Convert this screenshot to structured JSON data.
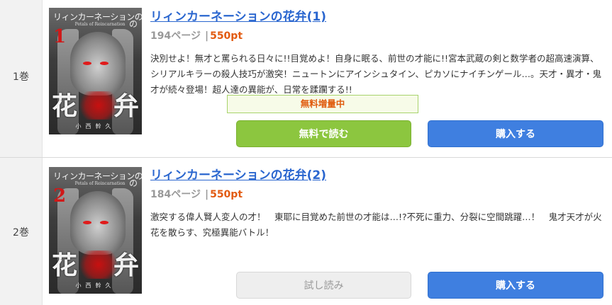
{
  "items": [
    {
      "volume": "1巻",
      "title": "リィンカーネーションの花弁(1)",
      "pages": "194ページ",
      "separator": "|",
      "price": "550pt",
      "description": "決別せよ！無才と罵られる日々に!!目覚めよ！自身に眠る、前世の才能に!!宮本武蔵の剣と数学者の超高速演算、シリアルキラーの殺人技巧が激突！ニュートンにアインシュタイン、ピカソにナイチンゲール…。天才・異才・鬼才が続々登場！超人達の異能が、日常を蹂躙する!!",
      "promo": "無料増量中",
      "primary_button": "無料で読む",
      "buy_button": "購入する",
      "cover": {
        "series_title": "リィンカーネーションの",
        "subtitle": "Petals of Reincarnation",
        "number": "1",
        "no": "の",
        "big_left": "花",
        "big_right": "弁",
        "author": "小西幹久"
      }
    },
    {
      "volume": "2巻",
      "title": "リィンカーネーションの花弁(2)",
      "pages": "184ページ",
      "separator": "|",
      "price": "550pt",
      "description": "激突する偉人賢人変人の才！　東耶に目覚めた前世の才能は…!?不死に重力、分裂に空間跳躍…！　鬼才天才が火花を散らす、究極異能バトル！",
      "primary_button": "試し読み",
      "buy_button": "購入する",
      "cover": {
        "series_title": "リィンカーネーションの",
        "subtitle": "Petals of Reincarnation",
        "number": "2",
        "no": "の",
        "big_left": "花",
        "big_right": "弁",
        "author": "小西幹久"
      }
    }
  ],
  "colors": {
    "link": "#2a66cf",
    "price": "#e25a10",
    "free_button": "#8cc63f",
    "buy_button": "#3f7fe0",
    "promo_text": "#e05a0c"
  }
}
